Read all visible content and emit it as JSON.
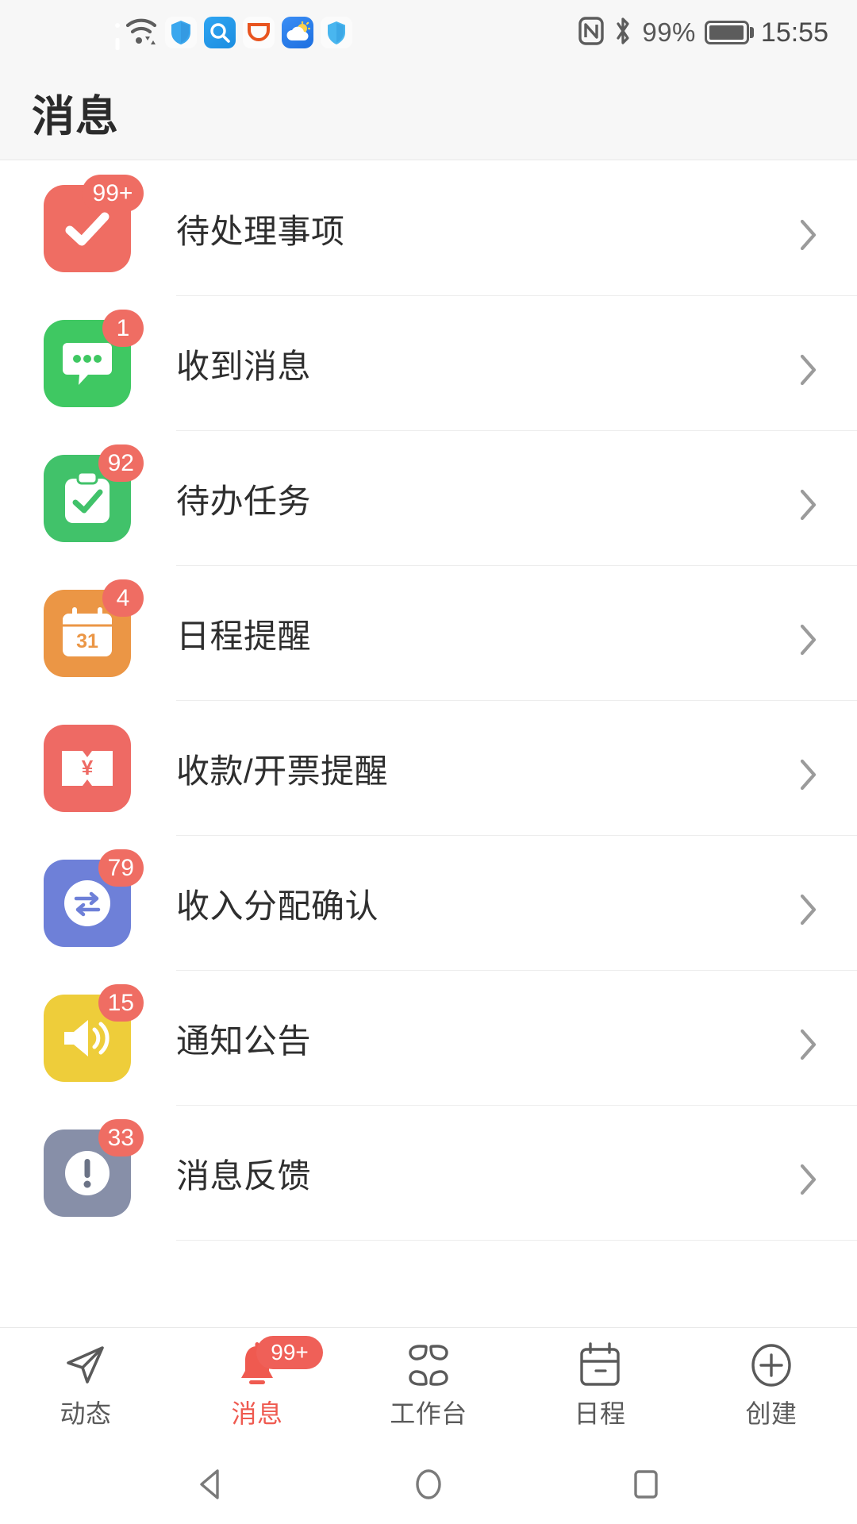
{
  "status_bar": {
    "left_icons": [
      {
        "name": "vibrate-icon",
        "label": "vibrate"
      },
      {
        "name": "wifi-icon",
        "label": "wifi"
      },
      {
        "name": "shield-app-icon",
        "label": "security-shield"
      },
      {
        "name": "search-app-icon",
        "label": "search"
      },
      {
        "name": "didi-app-icon",
        "label": "didi"
      },
      {
        "name": "weather-app-icon",
        "label": "weather"
      },
      {
        "name": "shield-app-icon-2",
        "label": "security-shield-2"
      }
    ],
    "nfc": "NFC",
    "bluetooth": "Bluetooth",
    "battery_percent": "99%",
    "battery_level": 99,
    "time": "15:55"
  },
  "header": {
    "title": "消息"
  },
  "list": {
    "items": [
      {
        "label": "待处理事项",
        "badge": "99+",
        "badge_wide": true,
        "icon": "check-circle-icon",
        "color": "#ef6d63"
      },
      {
        "label": "收到消息",
        "badge": "1",
        "badge_wide": false,
        "icon": "chat-bubble-icon",
        "color": "#3fc862"
      },
      {
        "label": "待办任务",
        "badge": "92",
        "badge_wide": false,
        "icon": "clipboard-check-icon",
        "color": "#41c26a"
      },
      {
        "label": "日程提醒",
        "badge": "4",
        "badge_wide": false,
        "icon": "calendar-31-icon",
        "color": "#eb9645"
      },
      {
        "label": "收款/开票提醒",
        "badge": "",
        "badge_wide": false,
        "icon": "invoice-yen-icon",
        "color": "#ee6a64"
      },
      {
        "label": "收入分配确认",
        "badge": "79",
        "badge_wide": false,
        "icon": "transfer-arrows-icon",
        "color": "#6e80d8"
      },
      {
        "label": "通知公告",
        "badge": "15",
        "badge_wide": false,
        "icon": "megaphone-icon",
        "color": "#eecd3a"
      },
      {
        "label": "消息反馈",
        "badge": "33",
        "badge_wide": false,
        "icon": "exclamation-circle-icon",
        "color": "#878fa8"
      }
    ],
    "chevron": "chevron-right-icon"
  },
  "tabbar": {
    "active_color": "#ef5a50",
    "inactive_color": "#5a5a5a",
    "tabs": [
      {
        "label": "动态",
        "icon": "paper-plane-icon",
        "active": false,
        "badge": ""
      },
      {
        "label": "消息",
        "icon": "bell-icon",
        "active": true,
        "badge": "99+"
      },
      {
        "label": "工作台",
        "icon": "grid-petals-icon",
        "active": false,
        "badge": ""
      },
      {
        "label": "日程",
        "icon": "calendar-icon",
        "active": false,
        "badge": ""
      },
      {
        "label": "创建",
        "icon": "plus-circle-icon",
        "active": false,
        "badge": ""
      }
    ]
  },
  "android_nav": {
    "back": "back-triangle-icon",
    "home": "home-circle-icon",
    "recents": "recents-square-icon"
  }
}
